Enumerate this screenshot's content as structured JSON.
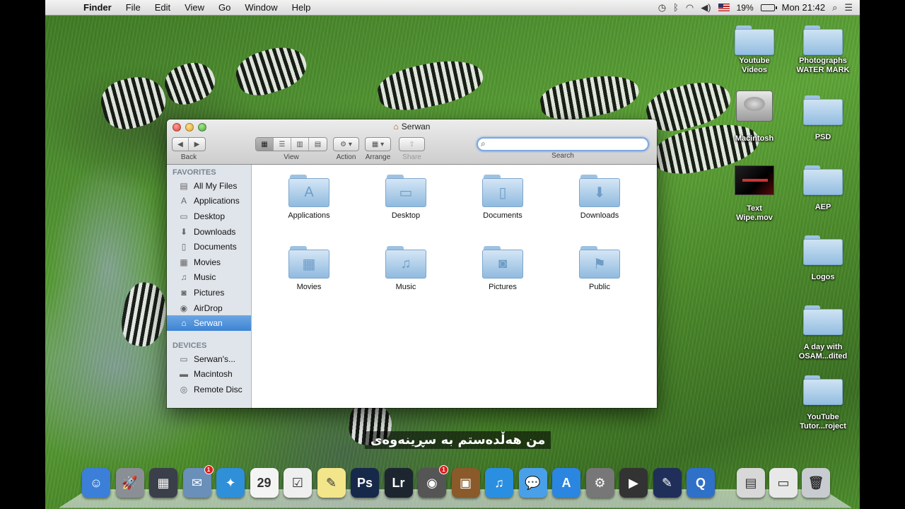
{
  "menubar": {
    "app_name": "Finder",
    "menus": [
      "File",
      "Edit",
      "View",
      "Go",
      "Window",
      "Help"
    ],
    "battery_percent": "19%",
    "clock": "Mon 21:42"
  },
  "desktop_icons": [
    {
      "label": "Youtube\nVideos",
      "type": "folder"
    },
    {
      "label": "Photographs\nWATER MARK",
      "type": "folder"
    },
    {
      "label": "Macintosh",
      "type": "hdd"
    },
    {
      "label": "PSD",
      "type": "folder"
    },
    {
      "label": "Text\nWipe.mov",
      "type": "movie"
    },
    {
      "label": "AEP",
      "type": "folder"
    },
    {
      "label": "Logos",
      "type": "folder"
    },
    {
      "label": "A day with\nOSAM...dited",
      "type": "folder"
    },
    {
      "label": "YouTube\nTutor...roject",
      "type": "folder"
    }
  ],
  "finder": {
    "title": "Serwan",
    "toolbar": {
      "back_label": "Back",
      "view_label": "View",
      "action_label": "Action",
      "arrange_label": "Arrange",
      "share_label": "Share",
      "search_label": "Search",
      "search_value": ""
    },
    "sidebar": {
      "favorites_header": "FAVORITES",
      "favorites": [
        {
          "label": "All My Files",
          "icon": "all-files-icon",
          "glyph": "▤"
        },
        {
          "label": "Applications",
          "icon": "applications-icon",
          "glyph": "A"
        },
        {
          "label": "Desktop",
          "icon": "desktop-icon",
          "glyph": "▭"
        },
        {
          "label": "Downloads",
          "icon": "downloads-icon",
          "glyph": "⬇"
        },
        {
          "label": "Documents",
          "icon": "documents-icon",
          "glyph": "▯"
        },
        {
          "label": "Movies",
          "icon": "movies-icon",
          "glyph": "▦"
        },
        {
          "label": "Music",
          "icon": "music-icon",
          "glyph": "♫"
        },
        {
          "label": "Pictures",
          "icon": "pictures-icon",
          "glyph": "◙"
        },
        {
          "label": "AirDrop",
          "icon": "airdrop-icon",
          "glyph": "◉"
        },
        {
          "label": "Serwan",
          "icon": "home-icon",
          "glyph": "⌂",
          "selected": true
        }
      ],
      "devices_header": "DEVICES",
      "devices": [
        {
          "label": "Serwan's...",
          "icon": "computer-icon",
          "glyph": "▭"
        },
        {
          "label": "Macintosh",
          "icon": "hdd-icon",
          "glyph": "▬"
        },
        {
          "label": "Remote Disc",
          "icon": "disc-icon",
          "glyph": "◎"
        }
      ]
    },
    "items": [
      {
        "label": "Applications",
        "glyph": "A",
        "icon": "applications-folder-icon"
      },
      {
        "label": "Desktop",
        "glyph": "▭",
        "icon": "desktop-folder-icon"
      },
      {
        "label": "Documents",
        "glyph": "▯",
        "icon": "documents-folder-icon"
      },
      {
        "label": "Downloads",
        "glyph": "⬇",
        "icon": "downloads-folder-icon"
      },
      {
        "label": "Movies",
        "glyph": "▦",
        "icon": "movies-folder-icon"
      },
      {
        "label": "Music",
        "glyph": "♫",
        "icon": "music-folder-icon"
      },
      {
        "label": "Pictures",
        "glyph": "◙",
        "icon": "pictures-folder-icon"
      },
      {
        "label": "Public",
        "glyph": "⚑",
        "icon": "public-folder-icon"
      }
    ]
  },
  "subtitle": "من هەڵدەستم بە سڕینەوەی",
  "dock": [
    {
      "name": "finder-dock-icon",
      "text": "☺",
      "color": "#3b7fd8"
    },
    {
      "name": "launchpad-dock-icon",
      "text": "🚀",
      "color": "#8a8f96"
    },
    {
      "name": "mission-control-dock-icon",
      "text": "▦",
      "color": "#3a3f4a"
    },
    {
      "name": "mail-dock-icon",
      "text": "✉",
      "color": "#6a8fb8",
      "badge": "1"
    },
    {
      "name": "safari-dock-icon",
      "text": "✦",
      "color": "#2f8fd8"
    },
    {
      "name": "calendar-dock-icon",
      "text": "29",
      "color": "#f4f4f4"
    },
    {
      "name": "reminders-dock-icon",
      "text": "☑",
      "color": "#efefef"
    },
    {
      "name": "notes-dock-icon",
      "text": "✎",
      "color": "#f3e58a"
    },
    {
      "name": "photoshop-dock-icon",
      "text": "Ps",
      "color": "#16294a"
    },
    {
      "name": "lightroom-dock-icon",
      "text": "Lr",
      "color": "#1d2530"
    },
    {
      "name": "facetime-dock-icon",
      "text": "◉",
      "color": "#555",
      "badge": "1"
    },
    {
      "name": "iphoto-dock-icon",
      "text": "▣",
      "color": "#8a5a2a"
    },
    {
      "name": "itunes-dock-icon",
      "text": "♫",
      "color": "#2a8fe0"
    },
    {
      "name": "messages-dock-icon",
      "text": "💬",
      "color": "#4aa0e8"
    },
    {
      "name": "app-store-dock-icon",
      "text": "A",
      "color": "#2a86e0"
    },
    {
      "name": "system-preferences-dock-icon",
      "text": "⚙",
      "color": "#777"
    },
    {
      "name": "final-cut-dock-icon",
      "text": "▶",
      "color": "#333"
    },
    {
      "name": "utility-dock-icon",
      "text": "✎",
      "color": "#1f2f5a"
    },
    {
      "name": "quicktime-dock-icon",
      "text": "Q",
      "color": "#2f70c8"
    },
    {
      "name": "applications-stack-dock-icon",
      "text": "▤",
      "color": "#d8d8d8"
    },
    {
      "name": "documents-stack-dock-icon",
      "text": "▭",
      "color": "#e8e8e8"
    },
    {
      "name": "trash-dock-icon",
      "text": "🗑",
      "color": "#c8ccd0"
    }
  ]
}
